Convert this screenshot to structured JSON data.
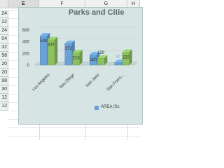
{
  "sheet": {
    "columns": [
      "E",
      "F",
      "G",
      "H"
    ],
    "selected_column": "E",
    "row_values": [
      "24",
      "22",
      "24",
      "04",
      "32",
      "58",
      "20",
      "20",
      "98",
      "30",
      "12",
      "12"
    ]
  },
  "chart_data": {
    "type": "bar",
    "title": "Parks and Citie",
    "categories": [
      "Los Angeles",
      "San Diego",
      "San Jose",
      "San Franc..."
    ],
    "series": [
      {
        "name": "AREA (Sc",
        "values": [
          503,
          372,
          180,
          47
        ],
        "color": "#6aa2d8"
      },
      {
        "name": "",
        "values": [
          437,
          213,
          120,
          220
        ],
        "color": "#8cc063"
      }
    ],
    "ylim": [
      0,
      600
    ],
    "yticks": [
      0,
      200,
      400,
      600
    ],
    "grid": true,
    "legend": "bottom-right"
  }
}
